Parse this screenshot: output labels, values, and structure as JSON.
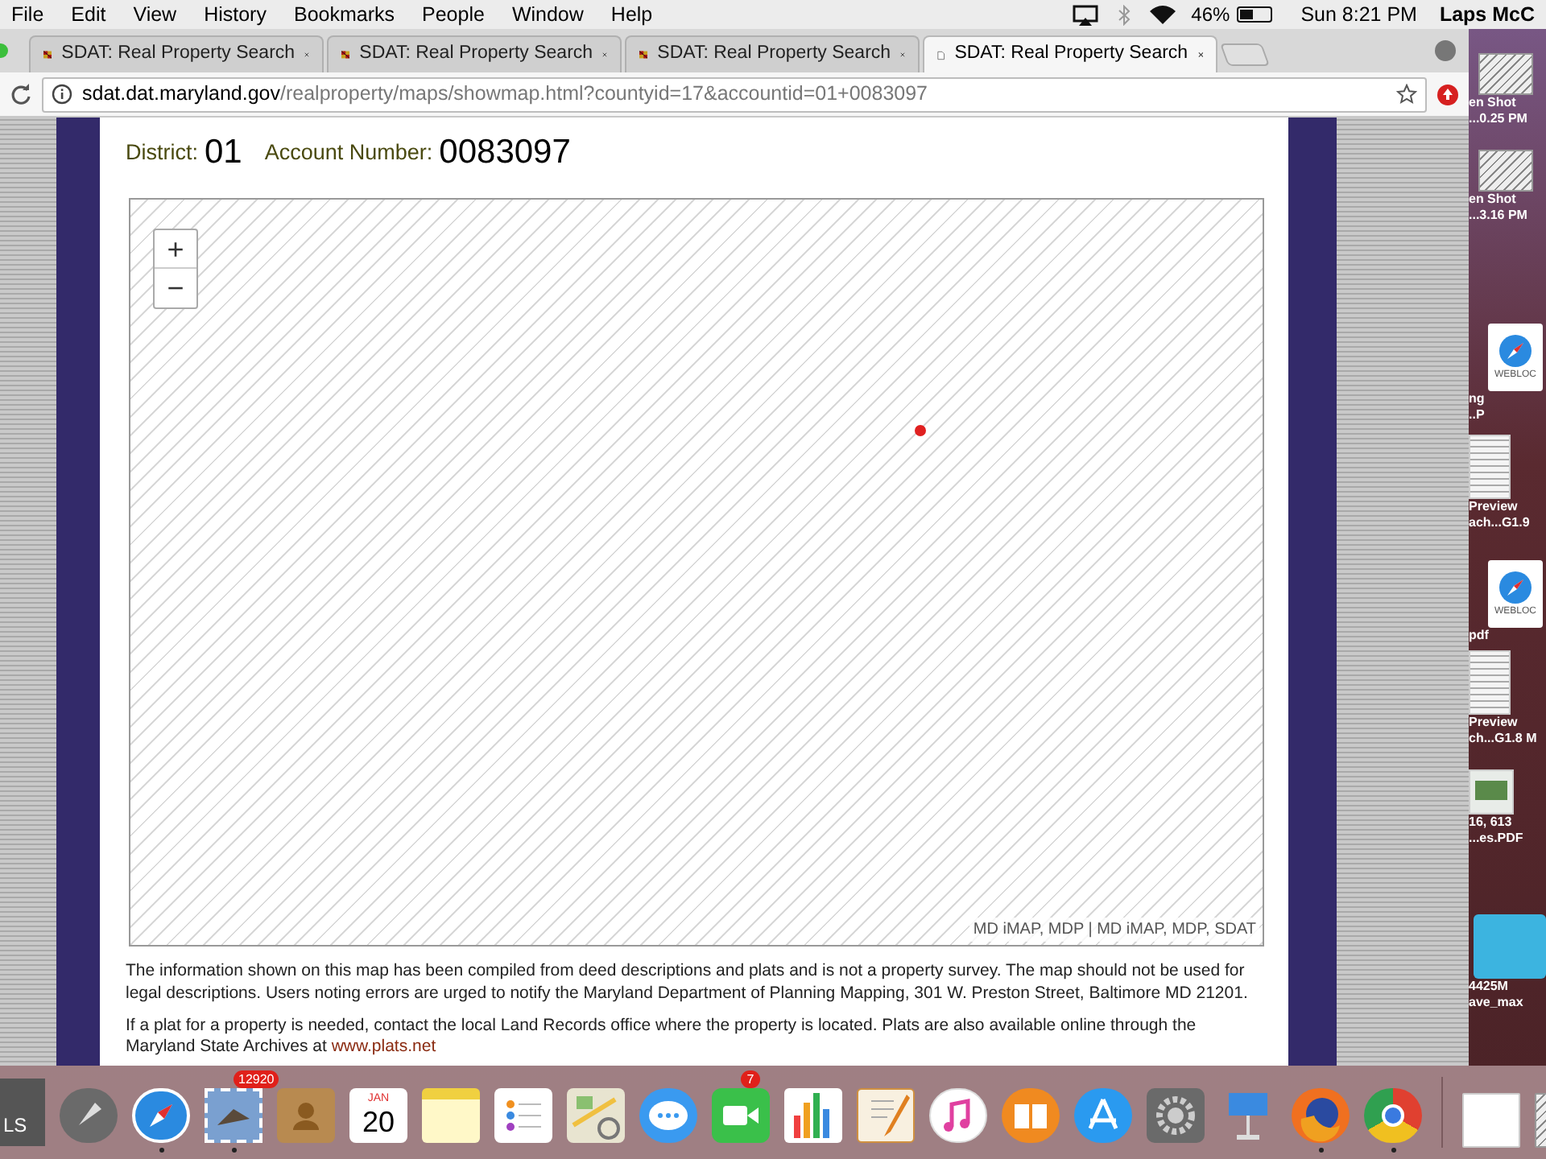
{
  "menu_bar": {
    "items": [
      "File",
      "Edit",
      "View",
      "History",
      "Bookmarks",
      "People",
      "Window",
      "Help"
    ],
    "battery": "46%",
    "clock": "Sun 8:21 PM",
    "user": "Laps McC"
  },
  "tabs": [
    {
      "title": "SDAT: Real Property Search",
      "selected": false,
      "kind": "flag"
    },
    {
      "title": "SDAT: Real Property Search",
      "selected": false,
      "kind": "flag"
    },
    {
      "title": "SDAT: Real Property Search",
      "selected": false,
      "kind": "flag"
    },
    {
      "title": "SDAT: Real Property Search",
      "selected": true,
      "kind": "page"
    }
  ],
  "address_bar": {
    "domain": "sdat.dat.maryland.gov",
    "path": "/realproperty/maps/showmap.html?countyid=17&accountid=01+0083097"
  },
  "page": {
    "district_label": "District:",
    "district": "01",
    "account_label": "Account Number:",
    "account": "0083097",
    "map": {
      "zoom_in": "+",
      "zoom_out": "−",
      "attribution": "MD iMAP, MDP | MD iMAP, MDP, SDAT"
    },
    "disclaimer": "The information shown on this map has been compiled from deed descriptions and plats and is not a property survey. The map should not be used for legal descriptions. Users noting errors are urged to notify the Maryland Department of Planning Mapping, 301 W. Preston Street, Baltimore MD 21201.",
    "plat_note": "If a plat for a property is needed, contact the local Land Records office where the property is located. Plats are also available online through the Maryland State Archives at",
    "plat_link": "www.plats.net"
  },
  "desktop_icons": [
    {
      "kind": "screenshot",
      "lines": [
        "en Shot",
        "...0.25 PM"
      ]
    },
    {
      "kind": "screenshot",
      "lines": [
        "en Shot",
        "...3.16 PM"
      ]
    },
    {
      "kind": "webloc",
      "badge": "WEBLOC",
      "lines": [
        "ng",
        "..P"
      ]
    },
    {
      "kind": "document",
      "lines": [
        "Preview",
        "ach...G1.9"
      ]
    },
    {
      "kind": "webloc",
      "badge": "WEBLOC",
      "lines": [
        "pdf"
      ]
    },
    {
      "kind": "document",
      "lines": [
        "Preview",
        "ch...G1.8 M"
      ]
    },
    {
      "kind": "photo",
      "lines": [
        "16, 613",
        "...es.PDF"
      ]
    },
    {
      "kind": "folder",
      "lines": [
        "4425M",
        "ave_max"
      ]
    }
  ],
  "dock": {
    "left_label": "LS",
    "items": [
      {
        "kind": "launchpad",
        "running": false
      },
      {
        "kind": "safari",
        "running": true
      },
      {
        "kind": "mail",
        "running": true,
        "badge": "12920"
      },
      {
        "kind": "contacts",
        "running": false
      },
      {
        "kind": "calendar",
        "running": false,
        "month": "JAN",
        "day": "20"
      },
      {
        "kind": "notes",
        "running": false
      },
      {
        "kind": "reminders",
        "running": false
      },
      {
        "kind": "maps",
        "running": false
      },
      {
        "kind": "messages",
        "running": false
      },
      {
        "kind": "facetime",
        "running": false,
        "badge": "7"
      },
      {
        "kind": "numbers",
        "running": false
      },
      {
        "kind": "pages",
        "running": false
      },
      {
        "kind": "itunes",
        "running": false
      },
      {
        "kind": "ibooks",
        "running": false
      },
      {
        "kind": "appstore",
        "running": false
      },
      {
        "kind": "settings",
        "running": false
      },
      {
        "kind": "keynote",
        "running": false
      },
      {
        "kind": "firefox",
        "running": true
      },
      {
        "kind": "chrome",
        "running": true
      },
      {
        "kind": "divider"
      },
      {
        "kind": "file"
      },
      {
        "kind": "screenshot"
      }
    ]
  }
}
